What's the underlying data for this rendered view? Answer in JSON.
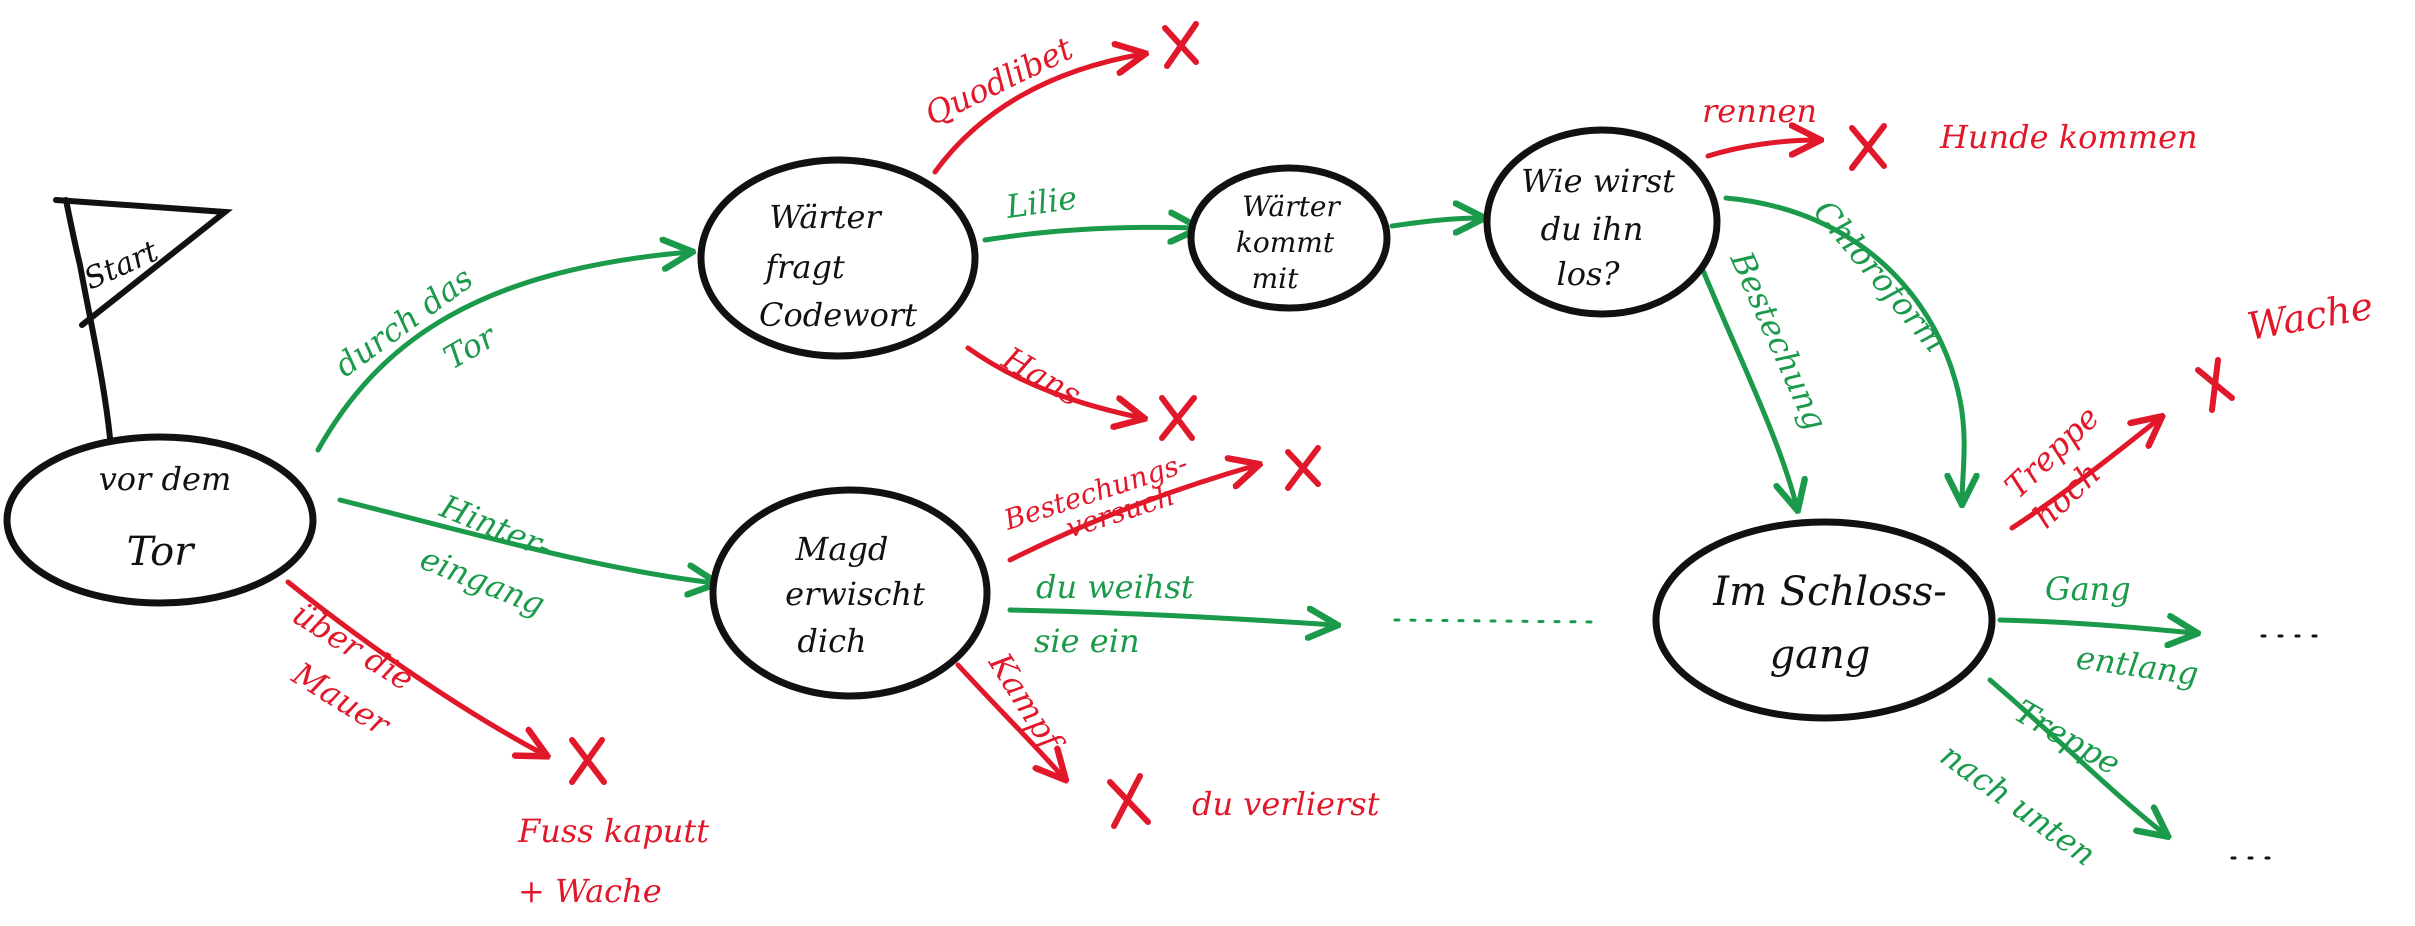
{
  "flag": {
    "label": "Start"
  },
  "nodes": {
    "vor_dem_tor": [
      "vor dem",
      "Tor"
    ],
    "waerter_fragt": [
      "Wärter",
      "fragt",
      "Codewort"
    ],
    "waerter_kommt": [
      "Wärter",
      "kommt",
      "mit"
    ],
    "wie_wirst": [
      "Wie wirst",
      "du ihn",
      "los?"
    ],
    "magd": [
      "Magd",
      "erwischt",
      "dich"
    ],
    "schlossgang": [
      "Im Schloss-",
      "gang"
    ]
  },
  "edges": {
    "durch_das_tor": [
      "durch das",
      "Tor"
    ],
    "hintereingang": [
      "Hinter-",
      "eingang"
    ],
    "ueber_die_mauer": [
      "über die",
      "Mauer"
    ],
    "quodlibet": "Quodlibet",
    "lilie": "Lilie",
    "hans": "Hans",
    "rennen": "rennen",
    "chloroform": "Chloroform",
    "bestechung": "Bestechung",
    "bestechungsversuch": [
      "Bestechungs-",
      "versuch"
    ],
    "du_weihst": [
      "du weihst",
      "sie ein"
    ],
    "kampf": "Kampf",
    "treppe_hoch": [
      "Treppe",
      "hoch"
    ],
    "gang_entlang": [
      "Gang",
      "entlang"
    ],
    "treppe_unten": [
      "Treppe",
      "nach unten"
    ]
  },
  "outcomes": {
    "fuss_kaputt": [
      "Fuss kaputt",
      "+ Wache"
    ],
    "hunde_kommen": "Hunde kommen",
    "du_verlierst": "du verlierst",
    "wache": "Wache"
  },
  "colors": {
    "node_stroke": "#111111",
    "success": "#1a9a4a",
    "failure": "#e0182a"
  }
}
